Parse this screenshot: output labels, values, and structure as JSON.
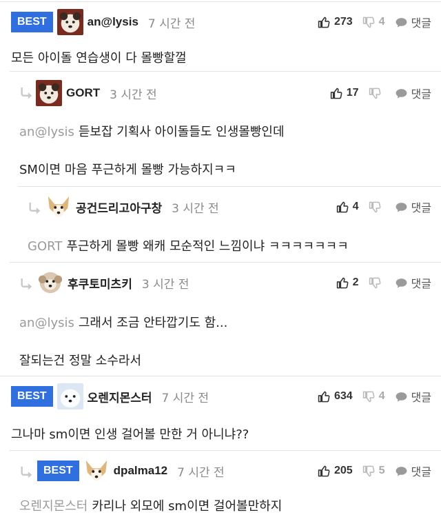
{
  "labels": {
    "best": "BEST",
    "reply": "댓글"
  },
  "comments": [
    {
      "best": true,
      "nick": "an@lysis",
      "time": "7 시간 전",
      "up": "273",
      "down": "4",
      "lines": [
        {
          "mention": "",
          "text": "모든 아이돌 연습생이 다 몰빵할껄"
        }
      ]
    },
    {
      "best": false,
      "nick": "GORT",
      "time": "3 시간 전",
      "up": "17",
      "down": "",
      "lines": [
        {
          "mention": "an@lysis",
          "text": "듣보잡 기획사 아이돌들도 인생몰빵인데"
        },
        {
          "mention": "",
          "text": "SM이면 마음 푸근하게 몰빵 가능하지ㅋㅋ"
        }
      ]
    },
    {
      "best": false,
      "nick": "공건드리고아구창",
      "time": "3 시간 전",
      "up": "4",
      "down": "",
      "lines": [
        {
          "mention": "GORT",
          "text": "푸근하게 몰빵 왜캐 모순적인 느낌이냐 ㅋㅋㅋㅋㅋㅋㅋ"
        }
      ]
    },
    {
      "best": false,
      "nick": "후쿠토미츠키",
      "time": "3 시간 전",
      "up": "2",
      "down": "",
      "lines": [
        {
          "mention": "an@lysis",
          "text": "그래서 조금 안타깝기도 함..."
        },
        {
          "mention": "",
          "text": "잘되는건 정말 소수라서"
        }
      ]
    },
    {
      "best": true,
      "nick": "오렌지몬스터",
      "time": "7 시간 전",
      "up": "634",
      "down": "4",
      "lines": [
        {
          "mention": "",
          "text": "그나마 sm이면 인생 걸어볼 만한 거 아니냐??"
        }
      ]
    },
    {
      "best": true,
      "nick": "dpalma12",
      "time": "7 시간 전",
      "up": "205",
      "down": "5",
      "lines": [
        {
          "mention": "오렌지몬스터",
          "text": "카리나 외모에 sm이면 걸어볼만하지"
        }
      ]
    }
  ]
}
